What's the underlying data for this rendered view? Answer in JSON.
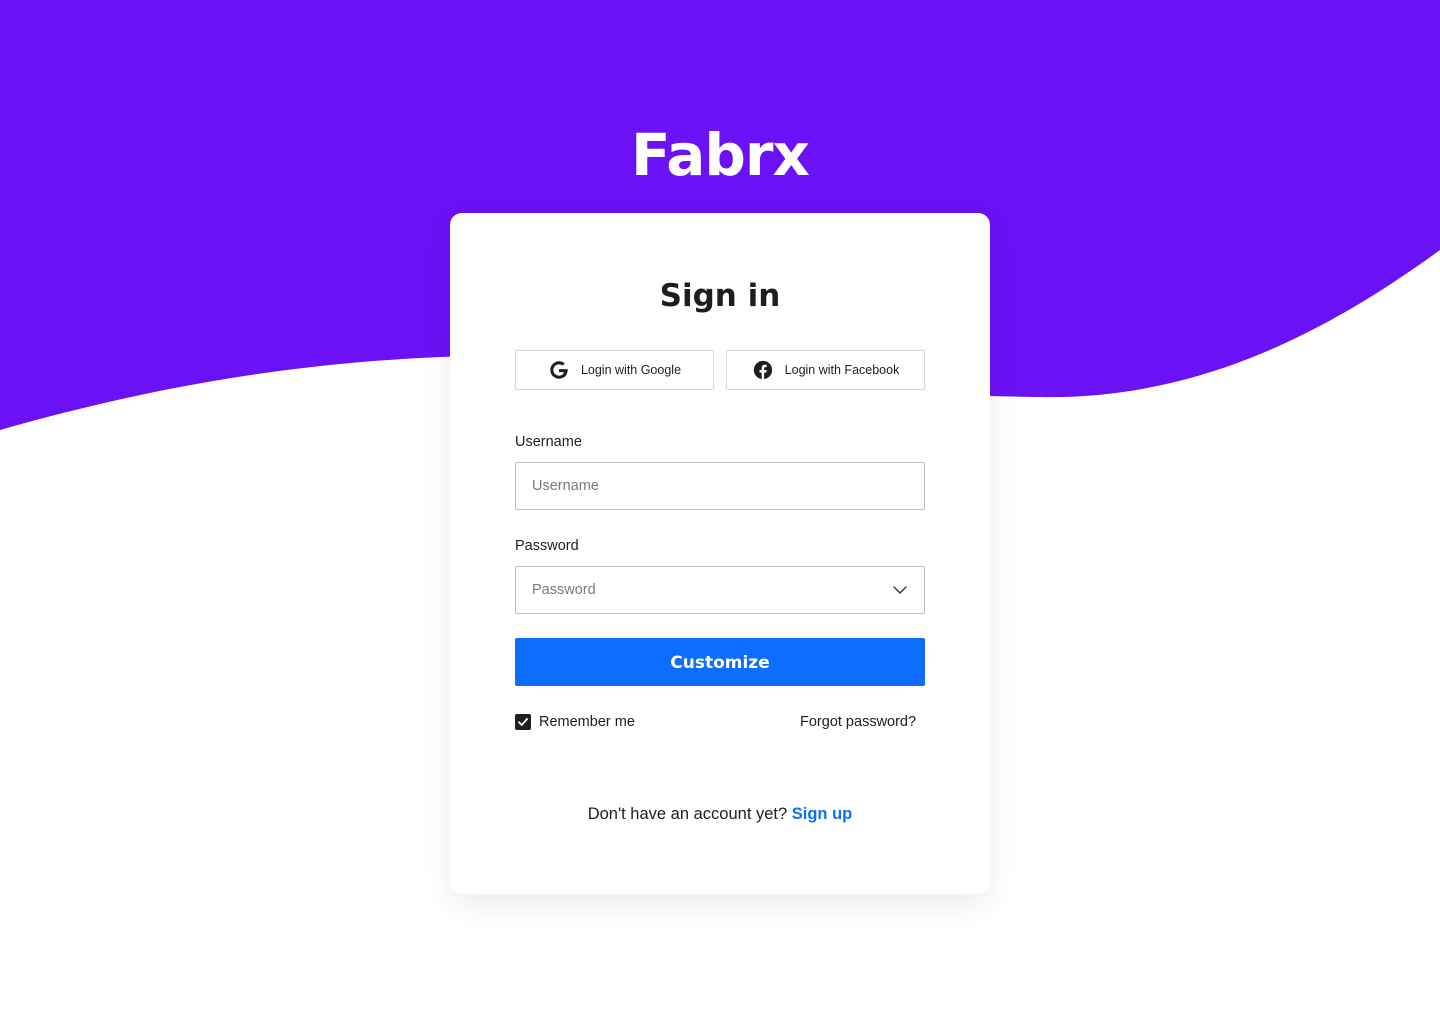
{
  "brand": {
    "logo": "Fabrx",
    "primary_color": "#6A11F5",
    "accent_color": "#0D6EFD"
  },
  "signin": {
    "title": "Sign in",
    "social": {
      "google_label": "Login with Google",
      "google_icon": "google-icon",
      "facebook_label": "Login with Facebook",
      "facebook_icon": "facebook-icon"
    },
    "username": {
      "label": "Username",
      "placeholder": "Username",
      "value": ""
    },
    "password": {
      "label": "Password",
      "placeholder": "Password",
      "value": "",
      "icon": "chevron-down-icon"
    },
    "submit_label": "Customize",
    "remember": {
      "label": "Remember me",
      "checked": true
    },
    "forgot_label": "Forgot password?",
    "signup": {
      "prompt": "Don't have an account yet?",
      "link_label": "Sign up"
    }
  }
}
